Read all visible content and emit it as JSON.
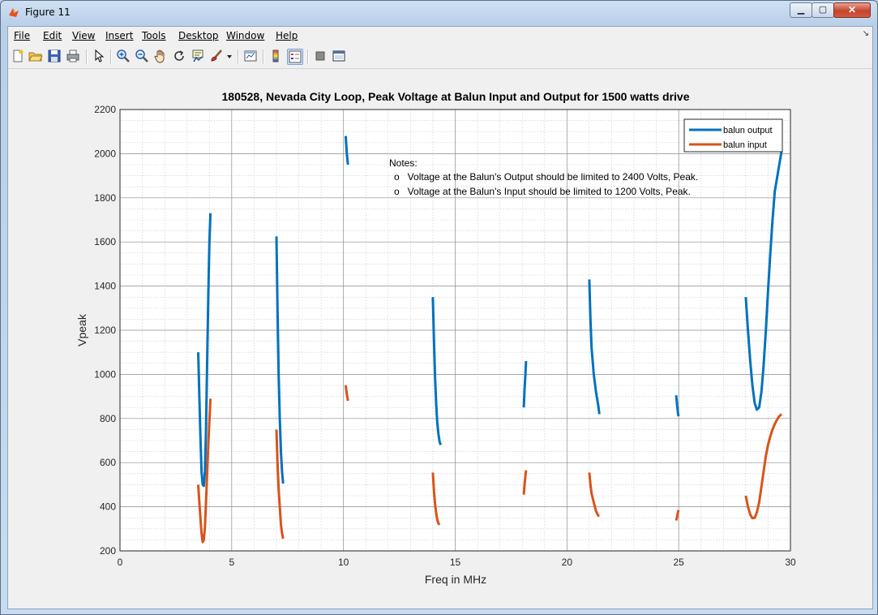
{
  "window": {
    "title": "Figure 11"
  },
  "menu": [
    "File",
    "Edit",
    "View",
    "Insert",
    "Tools",
    "Desktop",
    "Window",
    "Help"
  ],
  "toolbar": [
    "new-figure-icon",
    "open-file-icon",
    "save-icon",
    "print-icon",
    "pointer-icon",
    "zoom-in-icon",
    "zoom-out-icon",
    "pan-icon",
    "rotate-3d-icon",
    "data-cursor-icon",
    "brush-icon",
    "brush-dropdown-icon",
    "link-plot-icon",
    "insert-colorbar-icon",
    "insert-legend-icon",
    "hide-plot-tools-icon",
    "show-plot-tools-icon"
  ],
  "colors": {
    "output": "#0072bd",
    "input": "#d95319"
  },
  "chart_data": {
    "type": "line",
    "title": "180528, Nevada City Loop, Peak Voltage at Balun Input and Output for 1500 watts drive",
    "xlabel": "Freq in MHz",
    "ylabel": "Vpeak",
    "xlim": [
      0,
      30
    ],
    "ylim": [
      200,
      2200
    ],
    "xticks": [
      0,
      5,
      10,
      15,
      20,
      25,
      30
    ],
    "yticks": [
      200,
      400,
      600,
      800,
      1000,
      1200,
      1400,
      1600,
      1800,
      2000,
      2200
    ],
    "grid": true,
    "minor_grid": true,
    "legend": {
      "location": "top-right",
      "entries": [
        "balun output",
        "balun input"
      ]
    },
    "notes": [
      "Notes:",
      "o   Voltage at the Balun's Output should be limited to 2400 Volts, Peak.",
      "o   Voltage at the Balun's Input should be limited to 1200 Volts, Peak."
    ],
    "series": [
      {
        "name": "balun output",
        "segments": [
          [
            [
              3.5,
              1100
            ],
            [
              3.55,
              900
            ],
            [
              3.6,
              720
            ],
            [
              3.65,
              560
            ],
            [
              3.7,
              500
            ],
            [
              3.75,
              495
            ],
            [
              3.8,
              560
            ],
            [
              3.85,
              750
            ],
            [
              3.9,
              1050
            ],
            [
              3.95,
              1350
            ],
            [
              4.0,
              1600
            ],
            [
              4.05,
              1730
            ]
          ],
          [
            [
              7.0,
              1625
            ],
            [
              7.05,
              1300
            ],
            [
              7.1,
              1000
            ],
            [
              7.15,
              800
            ],
            [
              7.2,
              650
            ],
            [
              7.25,
              560
            ],
            [
              7.3,
              505
            ]
          ],
          [
            [
              10.1,
              2080
            ],
            [
              10.15,
              2000
            ],
            [
              10.2,
              1950
            ]
          ],
          [
            [
              14.0,
              1350
            ],
            [
              14.05,
              1150
            ],
            [
              14.1,
              980
            ],
            [
              14.15,
              860
            ],
            [
              14.2,
              780
            ],
            [
              14.25,
              730
            ],
            [
              14.3,
              695
            ],
            [
              14.35,
              680
            ]
          ],
          [
            [
              18.07,
              850
            ],
            [
              18.1,
              930
            ],
            [
              18.14,
              1000
            ],
            [
              18.17,
              1060
            ]
          ],
          [
            [
              21.0,
              1430
            ],
            [
              21.05,
              1250
            ],
            [
              21.1,
              1120
            ],
            [
              21.2,
              1000
            ],
            [
              21.3,
              920
            ],
            [
              21.4,
              860
            ],
            [
              21.45,
              820
            ]
          ],
          [
            [
              24.89,
              905
            ],
            [
              24.93,
              860
            ],
            [
              24.97,
              825
            ],
            [
              24.99,
              810
            ]
          ],
          [
            [
              28.0,
              1350
            ],
            [
              28.1,
              1200
            ],
            [
              28.2,
              1060
            ],
            [
              28.3,
              950
            ],
            [
              28.4,
              870
            ],
            [
              28.5,
              840
            ],
            [
              28.6,
              850
            ],
            [
              28.7,
              920
            ],
            [
              28.8,
              1040
            ],
            [
              28.9,
              1200
            ],
            [
              29.0,
              1380
            ],
            [
              29.1,
              1550
            ],
            [
              29.2,
              1700
            ],
            [
              29.3,
              1830
            ],
            [
              29.4,
              1890
            ],
            [
              29.5,
              1950
            ],
            [
              29.6,
              2010
            ]
          ]
        ]
      },
      {
        "name": "balun input",
        "segments": [
          [
            [
              3.5,
              500
            ],
            [
              3.55,
              420
            ],
            [
              3.6,
              350
            ],
            [
              3.65,
              280
            ],
            [
              3.7,
              240
            ],
            [
              3.75,
              250
            ],
            [
              3.8,
              310
            ],
            [
              3.85,
              420
            ],
            [
              3.9,
              550
            ],
            [
              3.95,
              680
            ],
            [
              4.0,
              790
            ],
            [
              4.05,
              890
            ]
          ],
          [
            [
              7.0,
              750
            ],
            [
              7.05,
              600
            ],
            [
              7.1,
              480
            ],
            [
              7.15,
              400
            ],
            [
              7.2,
              320
            ],
            [
              7.25,
              280
            ],
            [
              7.3,
              255
            ]
          ],
          [
            [
              10.1,
              950
            ],
            [
              10.15,
              910
            ],
            [
              10.2,
              880
            ]
          ],
          [
            [
              14.0,
              555
            ],
            [
              14.05,
              470
            ],
            [
              14.1,
              410
            ],
            [
              14.15,
              370
            ],
            [
              14.2,
              340
            ],
            [
              14.25,
              325
            ],
            [
              14.3,
              318
            ]
          ],
          [
            [
              18.07,
              455
            ],
            [
              18.1,
              500
            ],
            [
              18.14,
              540
            ],
            [
              18.17,
              565
            ]
          ],
          [
            [
              21.0,
              555
            ],
            [
              21.05,
              500
            ],
            [
              21.1,
              460
            ],
            [
              21.2,
              420
            ],
            [
              21.3,
              380
            ],
            [
              21.4,
              360
            ],
            [
              21.45,
              358
            ]
          ],
          [
            [
              24.89,
              338
            ],
            [
              24.93,
              355
            ],
            [
              24.97,
              375
            ],
            [
              24.99,
              385
            ]
          ],
          [
            [
              28.0,
              450
            ],
            [
              28.1,
              400
            ],
            [
              28.2,
              365
            ],
            [
              28.3,
              348
            ],
            [
              28.4,
              350
            ],
            [
              28.5,
              375
            ],
            [
              28.6,
              420
            ],
            [
              28.7,
              490
            ],
            [
              28.8,
              560
            ],
            [
              28.9,
              630
            ],
            [
              29.0,
              680
            ],
            [
              29.1,
              720
            ],
            [
              29.2,
              750
            ],
            [
              29.3,
              775
            ],
            [
              29.4,
              795
            ],
            [
              29.5,
              810
            ],
            [
              29.6,
              820
            ]
          ]
        ]
      }
    ]
  }
}
